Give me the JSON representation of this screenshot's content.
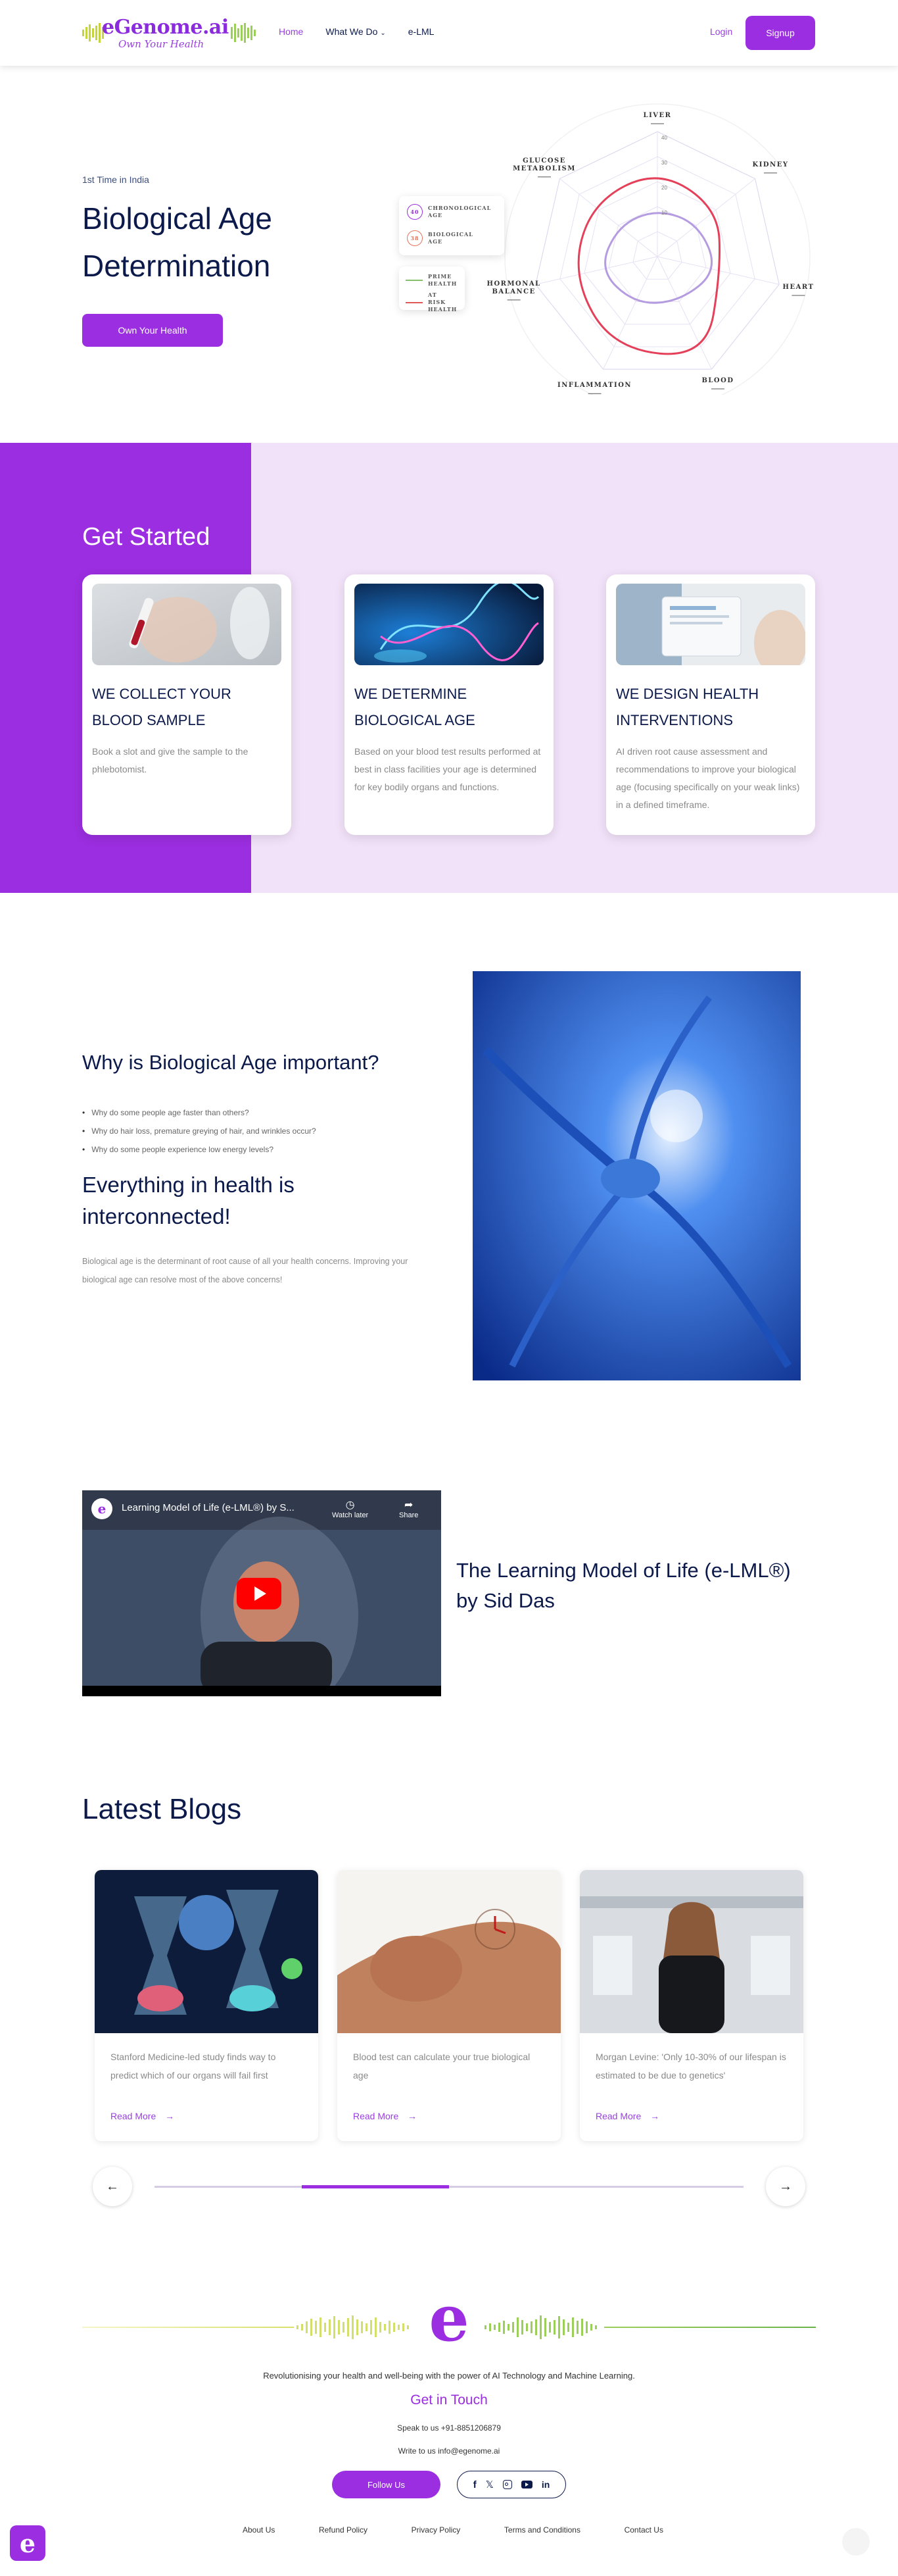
{
  "header": {
    "logo_text": "eGenome.ai",
    "logo_tagline": "Own Your Health",
    "nav": [
      {
        "label": "Home",
        "active": true
      },
      {
        "label": "What We Do",
        "has_dropdown": true
      },
      {
        "label": "e-LML"
      }
    ],
    "login": "Login",
    "signup": "Signup"
  },
  "hero": {
    "kicker": "1st Time in India",
    "title": "Biological Age Determination",
    "cta": "Own Your Health"
  },
  "radar": {
    "axes": [
      "LIVER",
      "KIDNEY",
      "HEART",
      "BLOOD",
      "INFLAMMATION",
      "HORMONAL BALANCE",
      "GLUCOSE METABOLISM"
    ],
    "ticks": [
      "40",
      "30",
      "20",
      "10"
    ],
    "chronological": {
      "badge": "40",
      "label": "CHRONOLOGICAL AGE"
    },
    "biological": {
      "badge": "38",
      "label": "BIOLOGICAL AGE"
    },
    "legend": [
      {
        "label": "PRIME HEALTH",
        "color": "#86c06a"
      },
      {
        "label": "AT RISK HEALTH",
        "color": "#e05757"
      }
    ],
    "series": [
      {
        "name": "PRIME HEALTH",
        "color": "#b59ce0",
        "values": [
          0.38,
          0.42,
          0.5,
          0.4,
          0.42,
          0.48,
          0.4
        ]
      },
      {
        "name": "AT RISK HEALTH",
        "color": "#e4405a",
        "values": [
          0.7,
          0.62,
          0.52,
          0.9,
          0.82,
          0.7,
          0.68
        ]
      }
    ]
  },
  "get_started": {
    "title": "Get Started",
    "cards": [
      {
        "title": "WE COLLECT YOUR BLOOD SAMPLE",
        "text": "Book a slot and give the sample to the phlebotomist."
      },
      {
        "title": "WE DETERMINE BIOLOGICAL AGE",
        "text": "Based on your blood test results performed at best in class facilities your age is determined for key bodily organs and functions."
      },
      {
        "title": "WE DESIGN HEALTH INTERVENTIONS",
        "text": "AI driven root cause assessment and recommendations to improve your biological age (focusing specifically on your weak links) in a defined timeframe."
      }
    ]
  },
  "why": {
    "title": "Why is Biological Age important?",
    "bullets": [
      "Why do some people age faster than others?",
      "Why do hair loss, premature greying of hair, and wrinkles occur?",
      "Why do some people experience low energy levels?"
    ],
    "subtitle": "Everything in health is interconnected!",
    "text": "Biological age is the determinant of root cause of all your health concerns. Improving your biological age can resolve most of the above concerns!"
  },
  "video": {
    "title": "Learning Model of Life (e-LML®) by S...",
    "watch_later": "Watch later",
    "share": "Share",
    "heading": "The Learning Model of Life (e-LML®) by Sid Das"
  },
  "blogs": {
    "title": "Latest Blogs",
    "read_more": "Read More",
    "items": [
      {
        "text": "Stanford Medicine-led study finds way to predict which of our organs will fail first"
      },
      {
        "text": "Blood test can calculate your true biological age"
      },
      {
        "text": "Morgan Levine: 'Only 10-30% of our lifespan is estimated to be due to genetics'"
      }
    ]
  },
  "footer": {
    "logo_letter": "e",
    "tagline": "Revolutionising your health and well-being with the power of AI Technology and Machine Learning.",
    "get_in_touch": "Get in Touch",
    "phone": "Speak to us +91-8851206879",
    "email": "Write to us info@egenome.ai",
    "follow": "Follow Us",
    "links": [
      "About Us",
      "Refund Policy",
      "Privacy Policy",
      "Terms and Conditions",
      "Contact Us"
    ]
  },
  "colors": {
    "brand": "#9b2ee0",
    "navy": "#0c1a4b",
    "tint": "#f2e2f9"
  }
}
